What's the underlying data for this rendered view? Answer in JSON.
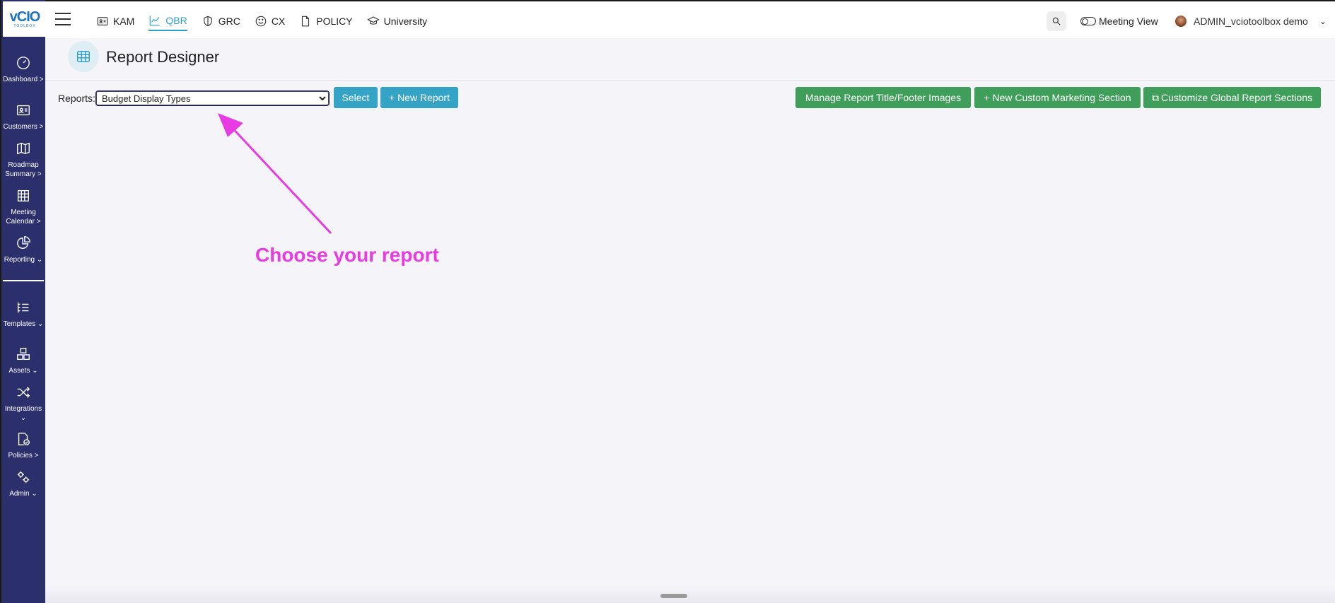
{
  "logo": {
    "text": "vCIO",
    "sub": "TOOLBOX"
  },
  "sidebar": {
    "items": [
      {
        "label": "Dashboard >",
        "icon": "gauge-icon"
      },
      {
        "label": "Customers >",
        "icon": "id-card-icon"
      },
      {
        "label": "Roadmap Summary >",
        "icon": "map-icon"
      },
      {
        "label": "Meeting Calendar >",
        "icon": "calendar-icon"
      },
      {
        "label": "Reporting ⌄",
        "icon": "pie-chart-icon"
      },
      {
        "label": "Templates ⌄",
        "icon": "list-icon"
      },
      {
        "label": "Assets ⌄",
        "icon": "boxes-icon"
      },
      {
        "label": "Integrations ⌄",
        "icon": "shuffle-icon"
      },
      {
        "label": "Policies >",
        "icon": "file-check-icon"
      },
      {
        "label": "Admin ⌄",
        "icon": "gears-icon"
      }
    ]
  },
  "topnav": {
    "items": [
      {
        "label": "KAM",
        "icon": "id-card-icon",
        "active": false
      },
      {
        "label": "QBR",
        "icon": "line-chart-icon",
        "active": true
      },
      {
        "label": "GRC",
        "icon": "shield-icon",
        "active": false
      },
      {
        "label": "CX",
        "icon": "smiley-icon",
        "active": false
      },
      {
        "label": "POLICY",
        "icon": "document-icon",
        "active": false
      },
      {
        "label": "University",
        "icon": "graduation-cap-icon",
        "active": false
      }
    ],
    "meeting_view": "Meeting View",
    "user_name": "ADMIN_vciotoolbox demo",
    "accent": "#2b9ec7"
  },
  "page": {
    "title": "Report Designer"
  },
  "reports": {
    "label": "Reports:",
    "selected": "Budget Display Types",
    "select_button": "Select",
    "new_report_button": "+ New Report",
    "manage_button": "Manage Report Title/Footer Images",
    "new_custom_button": "+ New Custom Marketing Section",
    "customize_button": "Customize Global Report Sections"
  },
  "annotation": {
    "text": "Choose your report",
    "color": "#e83ce3"
  },
  "colors": {
    "sidebar": "#2b2f6b",
    "button_blue": "#35a3c6",
    "button_green": "#3e9e5a"
  }
}
